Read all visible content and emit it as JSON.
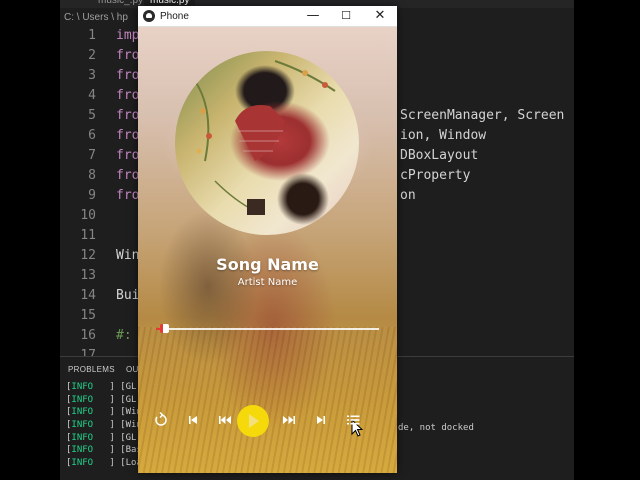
{
  "editor": {
    "tabs": [
      {
        "label": "music_.py",
        "active": false
      },
      {
        "label": "music.py",
        "active": true
      }
    ],
    "breadcrumb": "C: \\ Users \\ hp",
    "lines": [
      {
        "n": "1",
        "kw": "imp",
        "tail": ""
      },
      {
        "n": "2",
        "kw": "fro",
        "tail": ""
      },
      {
        "n": "3",
        "kw": "fro",
        "tail": ""
      },
      {
        "n": "4",
        "kw": "fro",
        "tail": ""
      },
      {
        "n": "5",
        "kw": "fro",
        "tail": "ScreenManager, Screen"
      },
      {
        "n": "6",
        "kw": "fro",
        "tail": "ion, Window"
      },
      {
        "n": "7",
        "kw": "fro",
        "tail": "DBoxLayout"
      },
      {
        "n": "8",
        "kw": "fro",
        "tail": "cProperty"
      },
      {
        "n": "9",
        "kw": "fro",
        "tail": "on"
      },
      {
        "n": "10",
        "kw": "",
        "tail": ""
      },
      {
        "n": "11",
        "kw": "",
        "tail": ""
      },
      {
        "n": "12",
        "kw": "Win",
        "tail": ""
      },
      {
        "n": "13",
        "kw": "",
        "tail": ""
      },
      {
        "n": "14",
        "kw": "Bui",
        "tail": ""
      },
      {
        "n": "15",
        "kw": "",
        "tail": ""
      },
      {
        "n": "16",
        "kw": "#:",
        "tail": ""
      },
      {
        "n": "17",
        "kw": "",
        "tail": ""
      }
    ],
    "panel_tabs": [
      "PROBLEMS",
      "OU"
    ],
    "terminal": [
      {
        "level": "INFO",
        "text": "[GL"
      },
      {
        "level": "INFO",
        "text": "[GL"
      },
      {
        "level": "INFO",
        "text": "[Win"
      },
      {
        "level": "INFO",
        "text": "[Win"
      },
      {
        "level": "INFO",
        "text": "[GL"
      },
      {
        "level": "INFO",
        "text": "[Bas"
      },
      {
        "level": "INFO",
        "text": "[Loa"
      }
    ],
    "terminal_tail": "de, not docked"
  },
  "window": {
    "title": "Phone",
    "minimize_glyph": "—",
    "maximize_glyph": "☐",
    "close_glyph": "✕"
  },
  "player": {
    "song_name": "Song Name",
    "artist_name": "Artist Name",
    "progress": 0.03,
    "accent_color": "#e53935",
    "play_button_color": "#f5d90a",
    "controls": {
      "repeat_icon": "repeat-icon",
      "previous_icon": "previous-icon",
      "rewind_icon": "rewind-icon",
      "play_icon": "play-icon",
      "fast_forward_icon": "fast-forward-icon",
      "next_icon": "next-icon",
      "playlist_icon": "playlist-icon"
    }
  }
}
